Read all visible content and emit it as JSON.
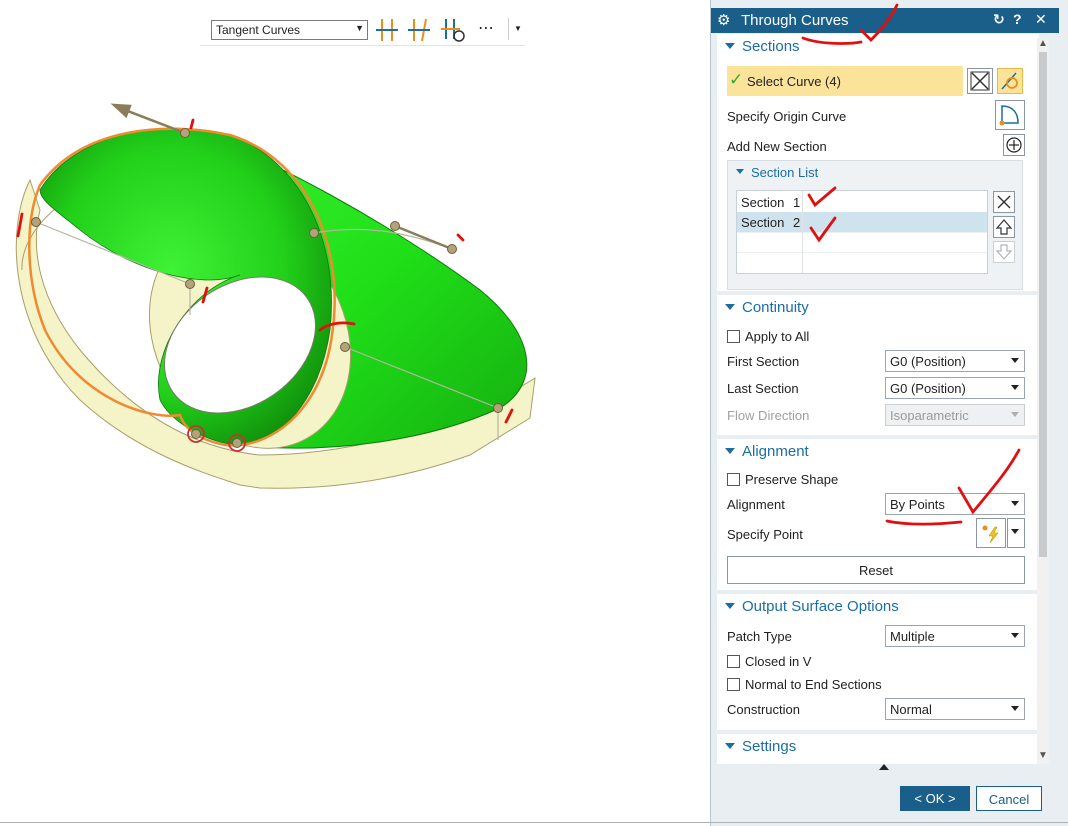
{
  "toolbar": {
    "filter_value": "Tangent Curves",
    "more_label": "⋯"
  },
  "dialog": {
    "title": "Through Curves",
    "title_buttons": {
      "reset": "↻",
      "help": "?",
      "close": "✕"
    },
    "sections": {
      "header": "Sections",
      "select_curve_label": "Select Curve (4)",
      "specify_origin_label": "Specify Origin Curve",
      "add_new_section_label": "Add New Section",
      "section_list": {
        "header": "Section List",
        "rows": [
          {
            "name": "Section",
            "index": "1"
          },
          {
            "name": "Section",
            "index": "2"
          }
        ],
        "selected_row": 1
      }
    },
    "continuity": {
      "header": "Continuity",
      "apply_to_all_label": "Apply to All",
      "apply_to_all_checked": false,
      "first_section_label": "First Section",
      "first_section_value": "G0 (Position)",
      "last_section_label": "Last Section",
      "last_section_value": "G0 (Position)",
      "flow_direction_label": "Flow Direction",
      "flow_direction_value": "Isoparametric"
    },
    "alignment": {
      "header": "Alignment",
      "preserve_shape_label": "Preserve Shape",
      "preserve_shape_checked": false,
      "alignment_label": "Alignment",
      "alignment_value": "By Points",
      "specify_point_label": "Specify Point",
      "reset_label": "Reset"
    },
    "output_surface": {
      "header": "Output Surface Options",
      "patch_type_label": "Patch Type",
      "patch_type_value": "Multiple",
      "closed_in_v_label": "Closed in V",
      "closed_in_v_checked": false,
      "normal_to_end_label": "Normal to End Sections",
      "normal_to_end_checked": false,
      "construction_label": "Construction",
      "construction_value": "Normal"
    },
    "settings": {
      "header": "Settings"
    },
    "ok_label": "< OK >",
    "cancel_label": "Cancel"
  },
  "colors": {
    "title_bar": "#1a5e8a",
    "group_header_text": "#1a6ea3",
    "surface_green": "#22e11a",
    "solid_cream": "#f5f3c8",
    "edge_orange": "#f08a30",
    "selection_yellow": "#fbe49a",
    "annotation_red": "#e01010"
  },
  "icons": [
    "gear-icon",
    "reset-icon",
    "help-icon",
    "close-icon",
    "check-icon",
    "curve-select-icon",
    "origin-curve-icon",
    "add-section-icon",
    "remove-section-icon",
    "move-up-icon",
    "move-down-icon",
    "point-snap-icon"
  ]
}
